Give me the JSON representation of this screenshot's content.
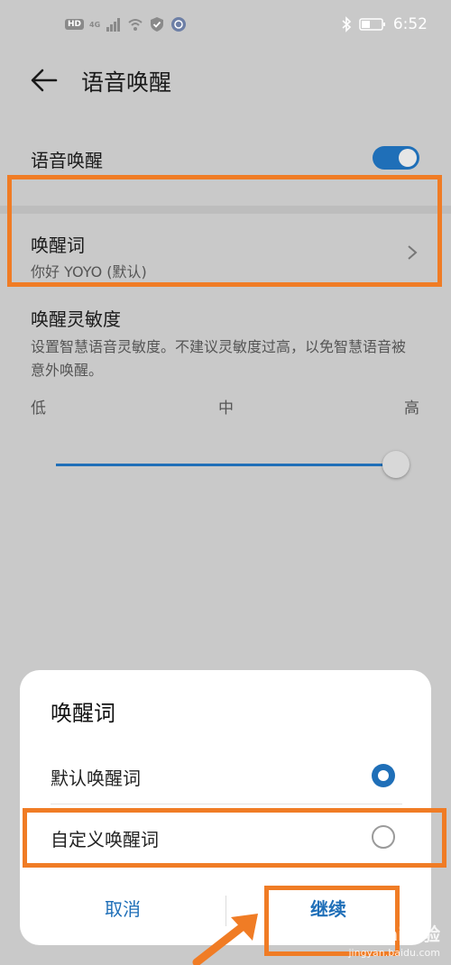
{
  "status_bar": {
    "hd_badge": "HD",
    "signal_label": "4G",
    "time": "6:52"
  },
  "header": {
    "title": "语音唤醒"
  },
  "voice_wake": {
    "label": "语音唤醒",
    "enabled": true
  },
  "wake_word": {
    "label": "唤醒词",
    "value": "你好 YOYO (默认)"
  },
  "sensitivity": {
    "title": "唤醒灵敏度",
    "description": "设置智慧语音灵敏度。不建议灵敏度过高，以免智慧语音被意外唤醒。",
    "ticks": {
      "low": "低",
      "mid": "中",
      "high": "高"
    },
    "level": 1.0
  },
  "dialog": {
    "title": "唤醒词",
    "options": [
      {
        "label": "默认唤醒词",
        "selected": true
      },
      {
        "label": "自定义唤醒词",
        "selected": false
      }
    ],
    "cancel_label": "取消",
    "continue_label": "继续"
  },
  "watermark": {
    "brand": "Bai经验",
    "url": "jingyan.baidu.com"
  },
  "colors": {
    "accent": "#1f6fb8",
    "highlight": "#f07c25",
    "overlay_bg": "#c9c9c9"
  }
}
